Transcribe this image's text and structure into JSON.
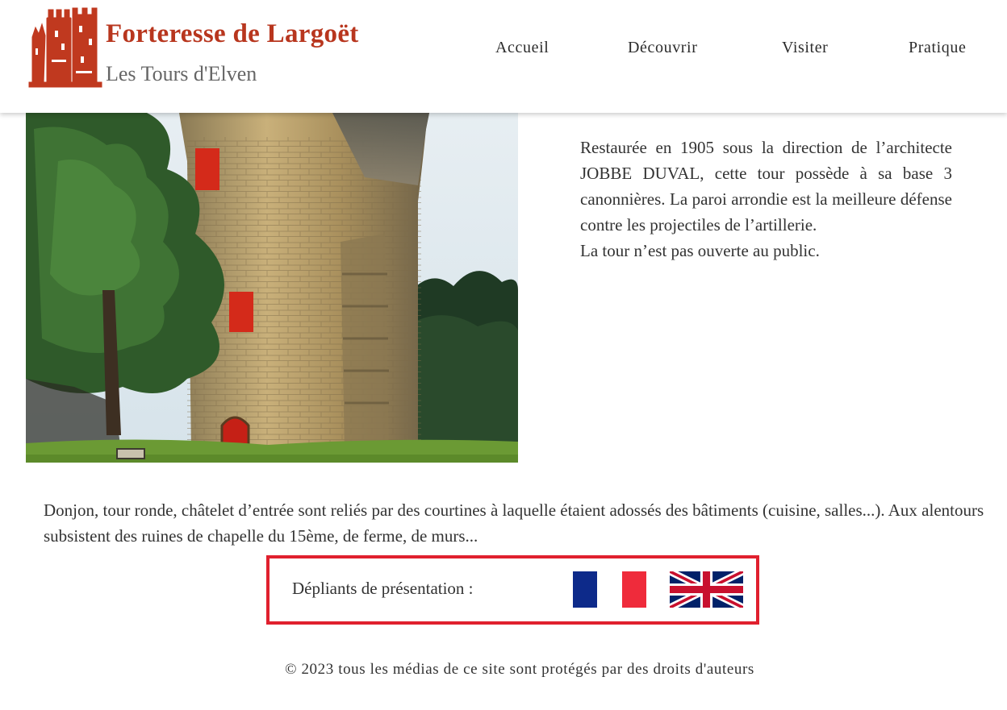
{
  "header": {
    "title": "Forteresse de Largoët",
    "subtitle": "Les Tours d'Elven",
    "logo_icon": "castle-logo-icon",
    "nav": [
      {
        "label": "Accueil"
      },
      {
        "label": "Découvrir"
      },
      {
        "label": "Visiter"
      },
      {
        "label": "Pratique"
      }
    ]
  },
  "colors": {
    "brand": "#b8361e",
    "accent_border": "#e0202e",
    "text": "#333333"
  },
  "tower": {
    "image_icon": "round-tower-photo",
    "paragraph": "Restaurée en 1905 sous la direction de l’architecte JOBBE DUVAL, cette tour possède à sa base 3 canonnières. La paroi arrondie est la meilleure défense contre les projectiles de l’artillerie.",
    "closed_note": "La tour n’est pas ouverte au public."
  },
  "main_text": "Donjon, tour ronde, châtelet d’entrée sont reliés par des courtines à laquelle étaient adossés des bâtiments (cuisine, salles...). Aux alentours subsistent des ruines de chapelle du 15ème, de ferme, de murs...",
  "brochures": {
    "label": "Dépliants de présentation :",
    "flags": [
      {
        "icon": "french-flag-icon"
      },
      {
        "icon": "uk-flag-icon"
      }
    ]
  },
  "footer": {
    "text": "© 2023 tous les médias de ce site sont protégés par des droits d'auteurs"
  }
}
